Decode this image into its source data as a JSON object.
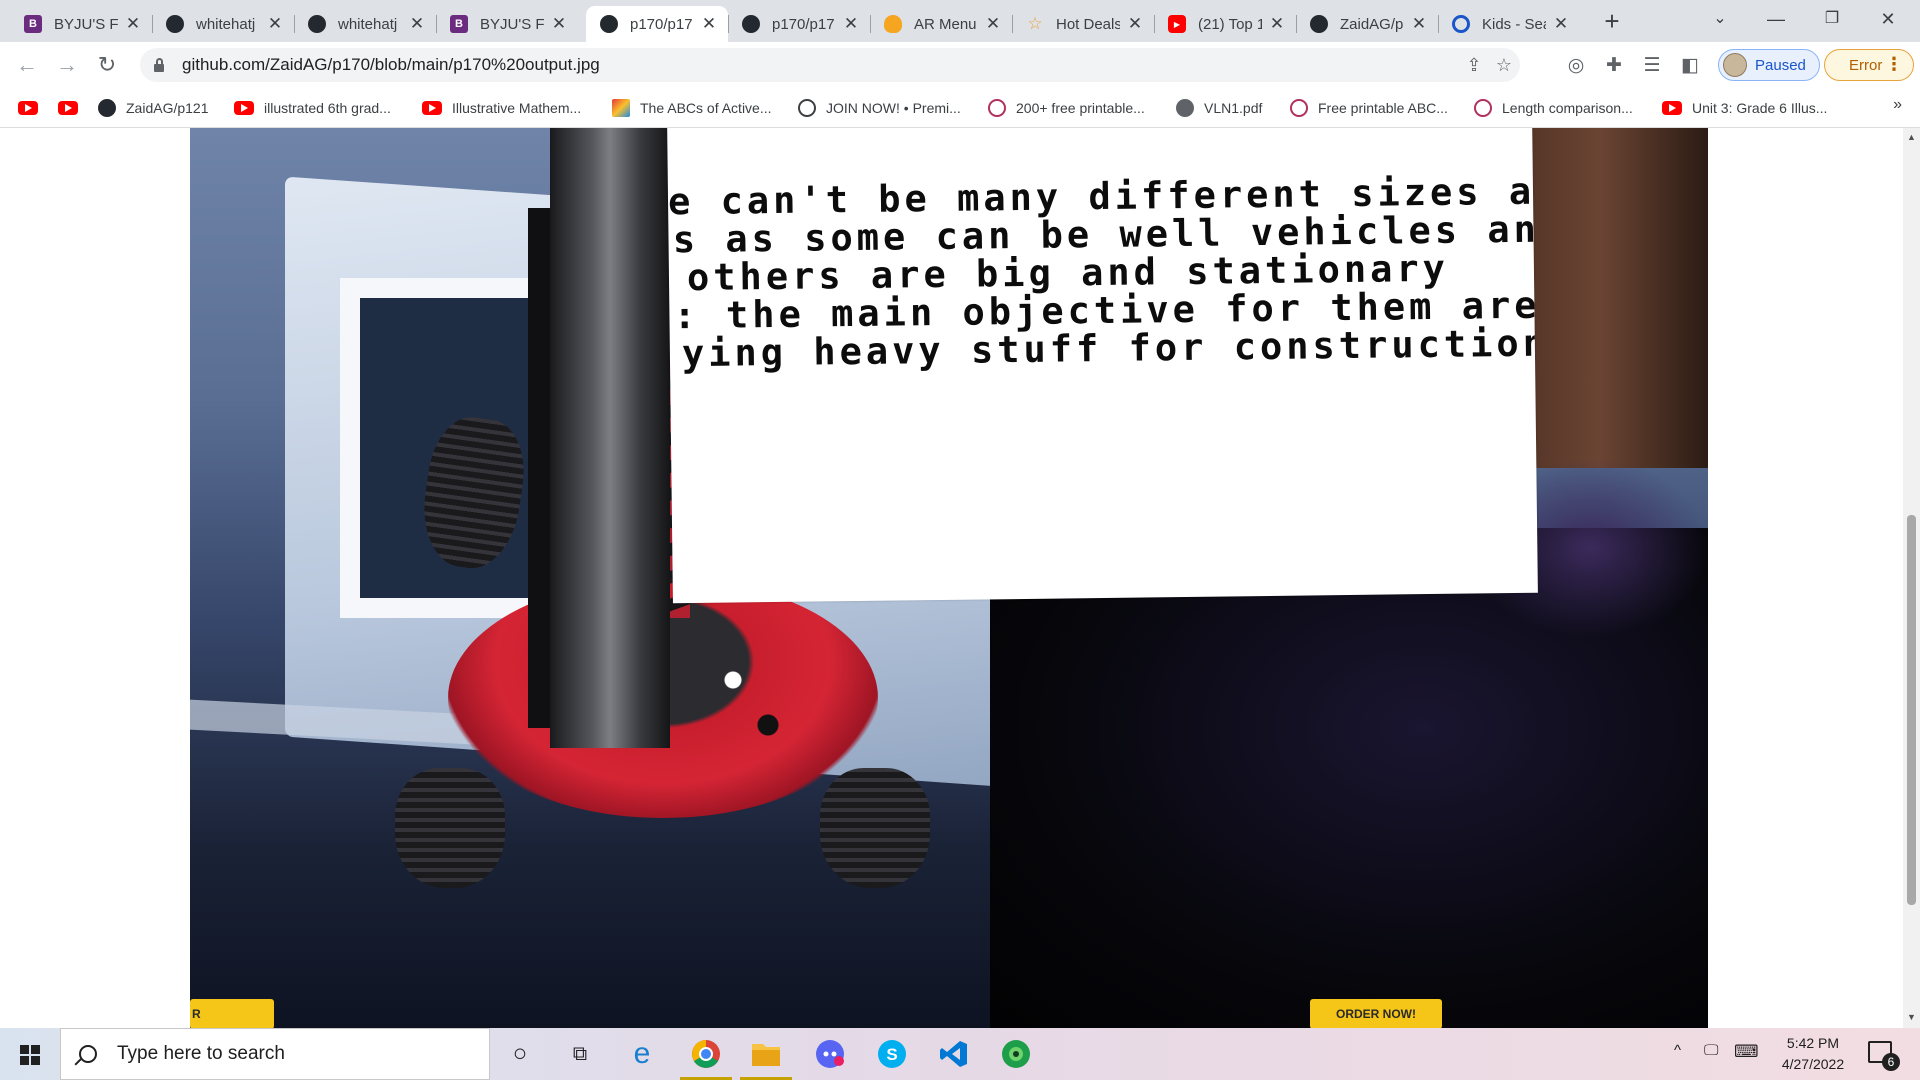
{
  "browser": {
    "tabs": [
      {
        "title": "BYJU'S Fu",
        "icon": "byjus-icon",
        "active": false
      },
      {
        "title": "whitehatj",
        "icon": "github-icon",
        "active": false
      },
      {
        "title": "whitehatj",
        "icon": "github-icon",
        "active": false
      },
      {
        "title": "BYJU'S Fu",
        "icon": "byjus-icon",
        "active": false
      },
      {
        "title": "p170/p17",
        "icon": "github-icon",
        "active": true
      },
      {
        "title": "p170/p17",
        "icon": "github-icon",
        "active": false
      },
      {
        "title": "AR Menu",
        "icon": "fire-icon",
        "active": false
      },
      {
        "title": "Hot Deals",
        "icon": "star-icon",
        "active": false
      },
      {
        "title": "(21) Top 1",
        "icon": "youtube-icon",
        "active": false
      },
      {
        "title": "ZaidAG/p",
        "icon": "github-icon",
        "active": false
      },
      {
        "title": "Kids - Sea",
        "icon": "ring-icon",
        "active": false
      }
    ],
    "url": "github.com/ZaidAG/p170/blob/main/p170%20output.jpg",
    "profile_label": "Paused",
    "error_label": "Error",
    "bookmarks": [
      {
        "label": "",
        "icon": "youtube-icon"
      },
      {
        "label": "",
        "icon": "youtube-icon"
      },
      {
        "label": "ZaidAG/p121",
        "icon": "github-icon"
      },
      {
        "label": "illustrated 6th grad...",
        "icon": "youtube-icon"
      },
      {
        "label": "Illustrative Mathem...",
        "icon": "youtube-icon"
      },
      {
        "label": "The ABCs of Active...",
        "icon": "abc-icon"
      },
      {
        "label": "JOIN NOW! • Premi...",
        "icon": "globe-icon"
      },
      {
        "label": "200+ free printable...",
        "icon": "free-icon"
      },
      {
        "label": "VLN1.pdf",
        "icon": "world-icon"
      },
      {
        "label": "Free printable ABC...",
        "icon": "free-icon"
      },
      {
        "label": "Length comparison...",
        "icon": "free-icon"
      },
      {
        "label": "Unit 3: Grade 6 Illus...",
        "icon": "youtube-icon"
      }
    ],
    "bookmarks_more": "»"
  },
  "content": {
    "sign_lines": [
      "e can't be many different sizes and",
      "es as some can be well vehicles and",
      "others are big and stationary",
      ": the main objective for them are",
      "ying heavy stuff for construction"
    ],
    "summary_button": "R SUMMARY!",
    "order_button": "ORDER NOW!",
    "accent_color": "#f5c518"
  },
  "taskbar": {
    "search_placeholder": "Type here to search",
    "time": "5:42 PM",
    "date": "4/27/2022",
    "notifications": "6",
    "apps": [
      "task-view-icon",
      "edge-icon",
      "chrome-icon",
      "file-explorer-icon",
      "discord-icon",
      "skype-icon",
      "vscode-icon",
      "edge-dev-icon"
    ]
  }
}
